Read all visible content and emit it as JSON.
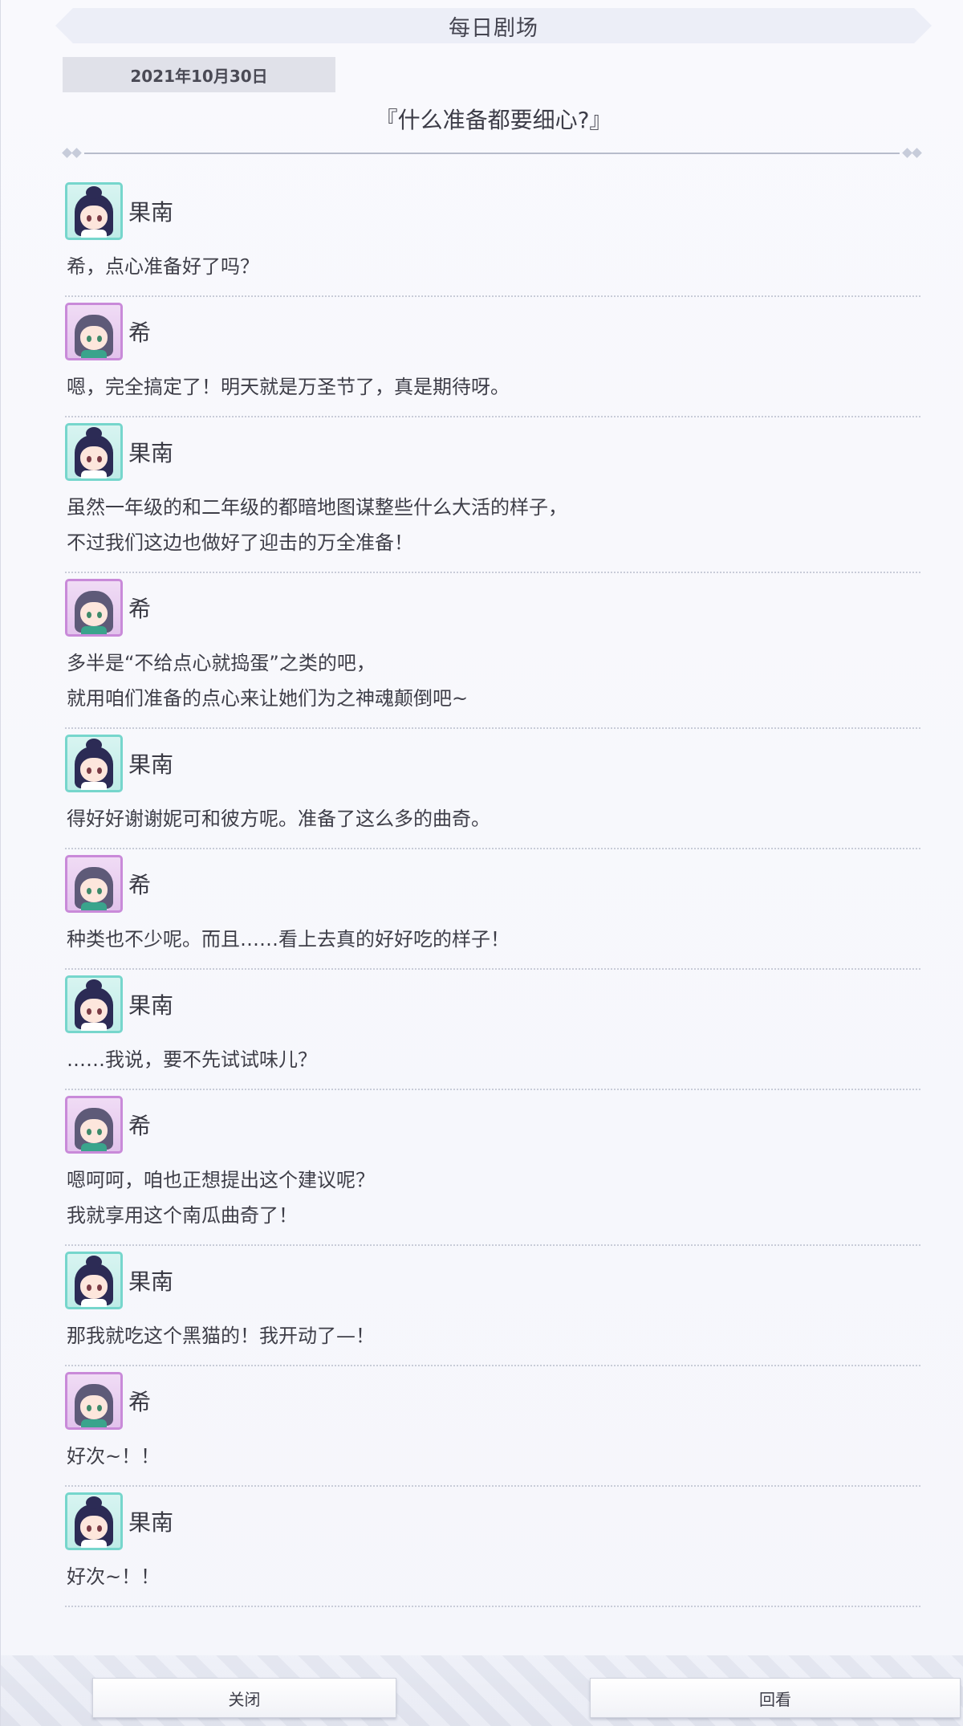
{
  "header": {
    "title": "每日剧场"
  },
  "episode": {
    "date": "2021年10月30日",
    "title": "『什么准备都要细心?』"
  },
  "dialogue": [
    {
      "speaker": "果南",
      "avatar": "kanan",
      "lines": [
        "希，点心准备好了吗？"
      ]
    },
    {
      "speaker": "希",
      "avatar": "nozomi",
      "lines": [
        "嗯，完全搞定了！明天就是万圣节了，真是期待呀。"
      ]
    },
    {
      "speaker": "果南",
      "avatar": "kanan",
      "lines": [
        "虽然一年级的和二年级的都暗地图谋整些什么大活的样子，",
        "不过我们这边也做好了迎击的万全准备！"
      ]
    },
    {
      "speaker": "希",
      "avatar": "nozomi",
      "lines": [
        "多半是“不给点心就捣蛋”之类的吧，",
        "就用咱们准备的点心来让她们为之神魂颠倒吧~"
      ]
    },
    {
      "speaker": "果南",
      "avatar": "kanan",
      "lines": [
        "得好好谢谢妮可和彼方呢。准备了这么多的曲奇。"
      ]
    },
    {
      "speaker": "希",
      "avatar": "nozomi",
      "lines": [
        "种类也不少呢。而且……看上去真的好好吃的样子！"
      ]
    },
    {
      "speaker": "果南",
      "avatar": "kanan",
      "lines": [
        "……我说，要不先试试味儿？"
      ]
    },
    {
      "speaker": "希",
      "avatar": "nozomi",
      "lines": [
        "嗯呵呵，咱也正想提出这个建议呢？",
        "我就享用这个南瓜曲奇了！"
      ]
    },
    {
      "speaker": "果南",
      "avatar": "kanan",
      "lines": [
        "那我就吃这个黑猫的！我开动了—！"
      ]
    },
    {
      "speaker": "希",
      "avatar": "nozomi",
      "lines": [
        "好次~！！"
      ]
    },
    {
      "speaker": "果南",
      "avatar": "kanan",
      "lines": [
        "好次~！！"
      ]
    }
  ],
  "footer": {
    "close_label": "关闭",
    "replay_label": "回看"
  }
}
